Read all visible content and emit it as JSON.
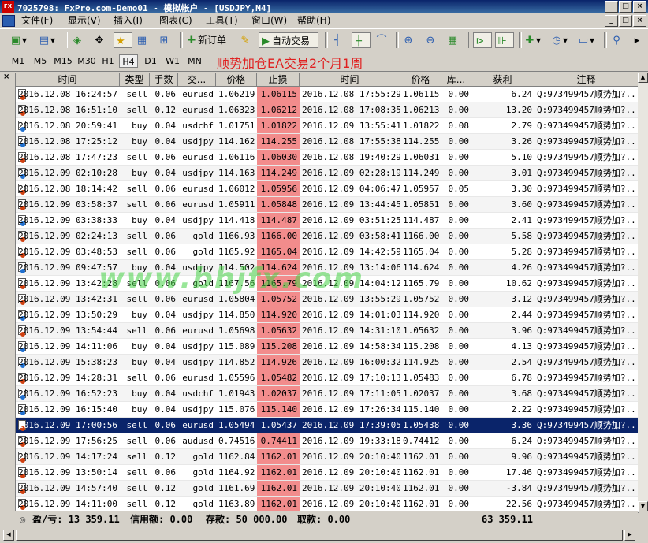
{
  "window": {
    "title": "7025798: FxPro.com-Demo01 - 模拟帐户 - [USDJPY,M4]",
    "app_icon": "FX",
    "win_buttons": [
      "_",
      "□",
      "×"
    ]
  },
  "menu": [
    "文件(F)",
    "显示(V)",
    "插入(I)",
    "图表(C)",
    "工具(T)",
    "窗口(W)",
    "帮助(H)"
  ],
  "mdi_buttons": [
    "_",
    "□",
    "×"
  ],
  "toolbar": {
    "new_order": "新订单",
    "auto_trade": "自动交易"
  },
  "timeframes": [
    "M1",
    "M5",
    "M15",
    "M30",
    "H1",
    "H4",
    "D1",
    "W1",
    "MN"
  ],
  "selected_timeframe": "H4",
  "overlay_title": "顺势加仓EA交易2个月1周",
  "watermark": "www.bhjfx.com",
  "table": {
    "close_label": "×",
    "columns": [
      "时间",
      "类型",
      "手数",
      "交...",
      "价格",
      "止损",
      "时间",
      "价格",
      "库...",
      "获利",
      "注释"
    ],
    "rows": [
      [
        "2016.12.08 16:24:57",
        "sell",
        "0.06",
        "eurusd",
        "1.06219",
        "1.06115",
        "2016.12.08 17:55:29",
        "1.06115",
        "0.00",
        "6.24",
        "Q:973499457顺势加?..."
      ],
      [
        "2016.12.08 16:51:10",
        "sell",
        "0.12",
        "eurusd",
        "1.06323",
        "1.06212",
        "2016.12.08 17:08:35",
        "1.06213",
        "0.00",
        "13.20",
        "Q:973499457顺势加?..."
      ],
      [
        "2016.12.08 20:59:41",
        "buy",
        "0.04",
        "usdchf",
        "1.01751",
        "1.01822",
        "2016.12.09 13:55:41",
        "1.01822",
        "0.08",
        "2.79",
        "Q:973499457顺势加?..."
      ],
      [
        "2016.12.08 17:25:12",
        "buy",
        "0.04",
        "usdjpy",
        "114.162",
        "114.255",
        "2016.12.08 17:55:38",
        "114.255",
        "0.00",
        "3.26",
        "Q:973499457顺势加?..."
      ],
      [
        "2016.12.08 17:47:23",
        "sell",
        "0.06",
        "eurusd",
        "1.06116",
        "1.06030",
        "2016.12.08 19:40:29",
        "1.06031",
        "0.00",
        "5.10",
        "Q:973499457顺势加?..."
      ],
      [
        "2016.12.09 02:10:28",
        "buy",
        "0.04",
        "usdjpy",
        "114.163",
        "114.249",
        "2016.12.09 02:28:19",
        "114.249",
        "0.00",
        "3.01",
        "Q:973499457顺势加?..."
      ],
      [
        "2016.12.08 18:14:42",
        "sell",
        "0.06",
        "eurusd",
        "1.06012",
        "1.05956",
        "2016.12.09 04:06:47",
        "1.05957",
        "0.05",
        "3.30",
        "Q:973499457顺势加?..."
      ],
      [
        "2016.12.09 03:58:37",
        "sell",
        "0.06",
        "eurusd",
        "1.05911",
        "1.05848",
        "2016.12.09 13:44:45",
        "1.05851",
        "0.00",
        "3.60",
        "Q:973499457顺势加?..."
      ],
      [
        "2016.12.09 03:38:33",
        "buy",
        "0.04",
        "usdjpy",
        "114.418",
        "114.487",
        "2016.12.09 03:51:25",
        "114.487",
        "0.00",
        "2.41",
        "Q:973499457顺势加?..."
      ],
      [
        "2016.12.09 02:24:13",
        "sell",
        "0.06",
        "gold",
        "1166.93",
        "1166.00",
        "2016.12.09 03:58:41",
        "1166.00",
        "0.00",
        "5.58",
        "Q:973499457顺势加?..."
      ],
      [
        "2016.12.09 03:48:53",
        "sell",
        "0.06",
        "gold",
        "1165.92",
        "1165.04",
        "2016.12.09 14:42:59",
        "1165.04",
        "0.00",
        "5.28",
        "Q:973499457顺势加?..."
      ],
      [
        "2016.12.09 09:47:57",
        "buy",
        "0.04",
        "usdjpy",
        "114.502",
        "114.624",
        "2016.12.09 13:14:06",
        "114.624",
        "0.00",
        "4.26",
        "Q:973499457顺势加?..."
      ],
      [
        "2016.12.09 13:42:28",
        "sell",
        "0.06",
        "gold",
        "1167.56",
        "1165.79",
        "2016.12.09 14:04:12",
        "1165.79",
        "0.00",
        "10.62",
        "Q:973499457顺势加?..."
      ],
      [
        "2016.12.09 13:42:31",
        "sell",
        "0.06",
        "eurusd",
        "1.05804",
        "1.05752",
        "2016.12.09 13:55:29",
        "1.05752",
        "0.00",
        "3.12",
        "Q:973499457顺势加?..."
      ],
      [
        "2016.12.09 13:50:29",
        "buy",
        "0.04",
        "usdjpy",
        "114.850",
        "114.920",
        "2016.12.09 14:01:03",
        "114.920",
        "0.00",
        "2.44",
        "Q:973499457顺势加?..."
      ],
      [
        "2016.12.09 13:54:44",
        "sell",
        "0.06",
        "eurusd",
        "1.05698",
        "1.05632",
        "2016.12.09 14:31:10",
        "1.05632",
        "0.00",
        "3.96",
        "Q:973499457顺势加?..."
      ],
      [
        "2016.12.09 14:11:06",
        "buy",
        "0.04",
        "usdjpy",
        "115.089",
        "115.208",
        "2016.12.09 14:58:34",
        "115.208",
        "0.00",
        "4.13",
        "Q:973499457顺势加?..."
      ],
      [
        "2016.12.09 15:38:23",
        "buy",
        "0.04",
        "usdjpy",
        "114.852",
        "114.926",
        "2016.12.09 16:00:32",
        "114.925",
        "0.00",
        "2.54",
        "Q:973499457顺势加?..."
      ],
      [
        "2016.12.09 14:28:31",
        "sell",
        "0.06",
        "eurusd",
        "1.05596",
        "1.05482",
        "2016.12.09 17:10:13",
        "1.05483",
        "0.00",
        "6.78",
        "Q:973499457顺势加?..."
      ],
      [
        "2016.12.09 16:52:23",
        "buy",
        "0.04",
        "usdchf",
        "1.01943",
        "1.02037",
        "2016.12.09 17:11:05",
        "1.02037",
        "0.00",
        "3.68",
        "Q:973499457顺势加?..."
      ],
      [
        "2016.12.09 16:15:40",
        "buy",
        "0.04",
        "usdjpy",
        "115.076",
        "115.140",
        "2016.12.09 17:26:34",
        "115.140",
        "0.00",
        "2.22",
        "Q:973499457顺势加?..."
      ],
      [
        "2016.12.09 17:00:56",
        "sell",
        "0.06",
        "eurusd",
        "1.05494",
        "1.05437",
        "2016.12.09 17:39:05",
        "1.05438",
        "0.00",
        "3.36",
        "Q:973499457顺势加?..."
      ],
      [
        "2016.12.09 17:56:25",
        "sell",
        "0.06",
        "audusd",
        "0.74516",
        "0.74411",
        "2016.12.09 19:33:18",
        "0.74412",
        "0.00",
        "6.24",
        "Q:973499457顺势加?..."
      ],
      [
        "2016.12.09 14:17:24",
        "sell",
        "0.12",
        "gold",
        "1162.84",
        "1162.01",
        "2016.12.09 20:10:40",
        "1162.01",
        "0.00",
        "9.96",
        "Q:973499457顺势加?..."
      ],
      [
        "2016.12.09 13:50:14",
        "sell",
        "0.06",
        "gold",
        "1164.92",
        "1162.01",
        "2016.12.09 20:10:40",
        "1162.01",
        "0.00",
        "17.46",
        "Q:973499457顺势加?..."
      ],
      [
        "2016.12.09 14:57:40",
        "sell",
        "0.12",
        "gold",
        "1161.69",
        "1162.01",
        "2016.12.09 20:10:40",
        "1162.01",
        "0.00",
        "-3.84",
        "Q:973499457顺势加?..."
      ],
      [
        "2016.12.09 14:11:00",
        "sell",
        "0.12",
        "gold",
        "1163.89",
        "1162.01",
        "2016.12.09 20:10:40",
        "1162.01",
        "0.00",
        "22.56",
        "Q:973499457顺势加?..."
      ]
    ],
    "selected_row": 21
  },
  "footer": {
    "pl": "盈/亏: 13 359.11",
    "credit": "信用额: 0.00",
    "deposit": "存款: 50 000.00",
    "withdraw": "取款: 0.00",
    "total": "63 359.11"
  },
  "colors": {
    "titlebar": "#0a246a",
    "stoploss_fill": "#f28c8c",
    "selected_row": "#0a246a",
    "overlay_title": "#e02020",
    "watermark": "#46d246"
  }
}
